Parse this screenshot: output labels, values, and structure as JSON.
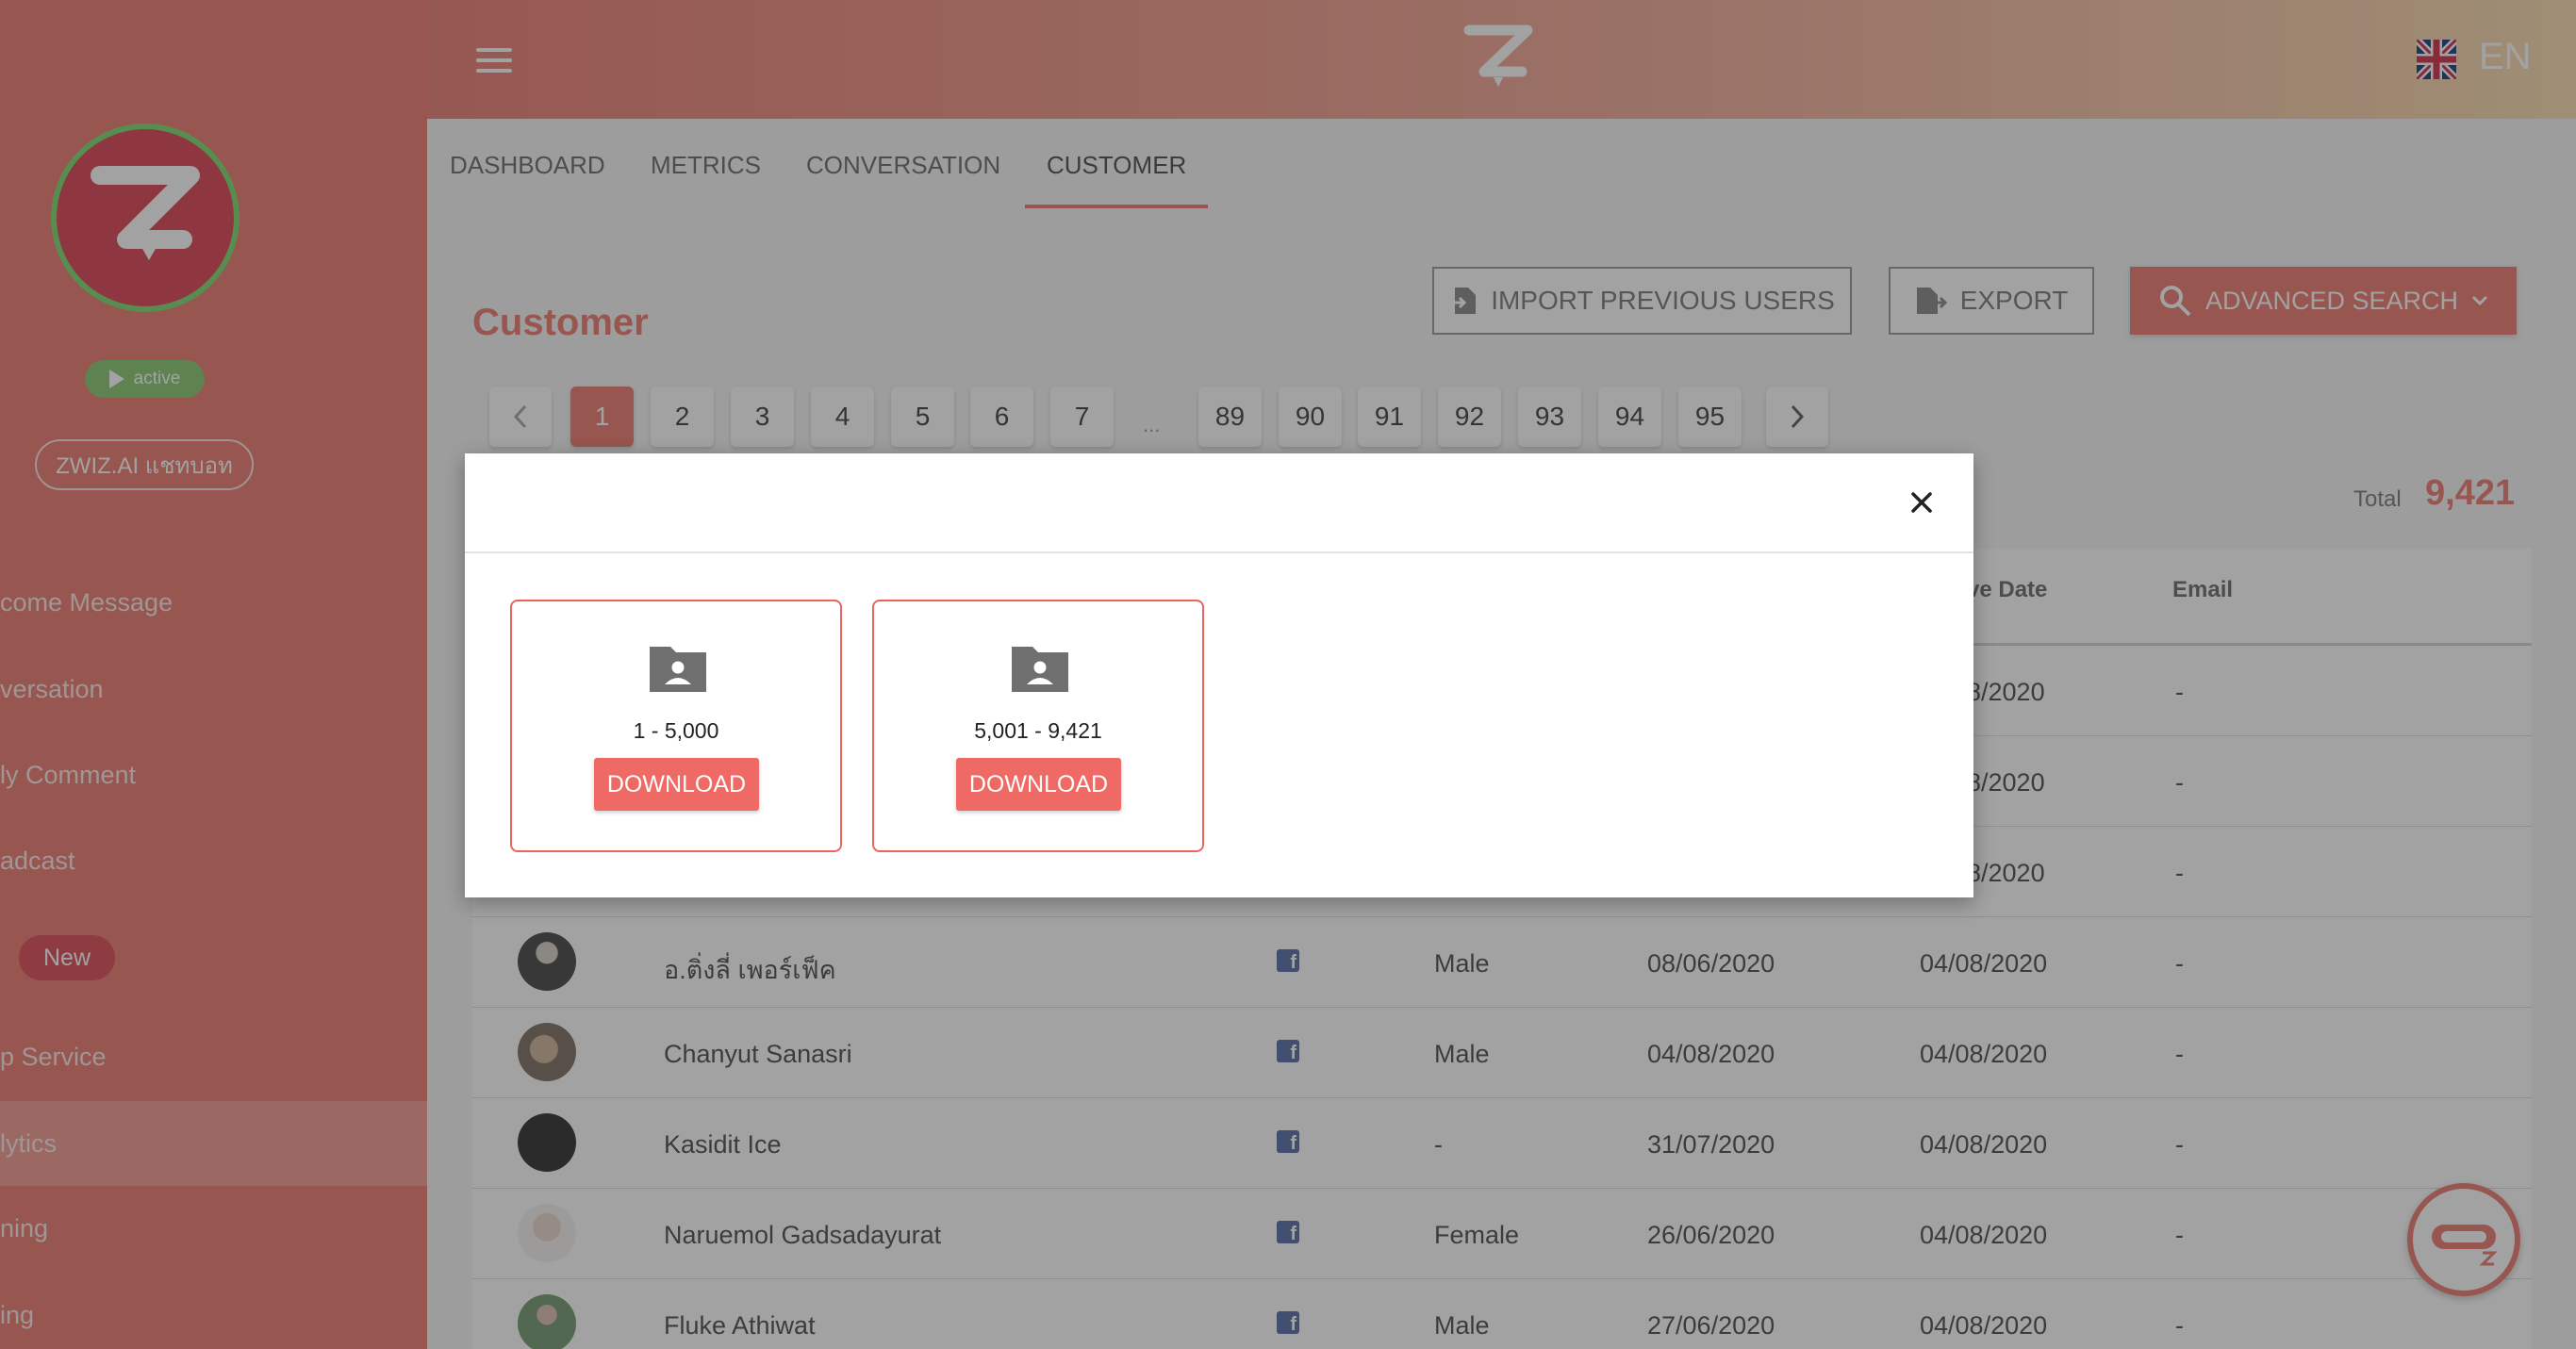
{
  "sidebar": {
    "status": "active",
    "bot_name": "ZWIZ.AI แชทบอท",
    "new_badge": "New",
    "items": [
      {
        "label": "come Message"
      },
      {
        "label": "versation"
      },
      {
        "label": "ly Comment"
      },
      {
        "label": "adcast"
      },
      {
        "label": "p Service"
      },
      {
        "label": "lytics"
      },
      {
        "label": "ning"
      },
      {
        "label": "ing"
      }
    ]
  },
  "header": {
    "language": "EN"
  },
  "tabs": [
    {
      "label": "DASHBOARD"
    },
    {
      "label": "METRICS"
    },
    {
      "label": "CONVERSATION"
    },
    {
      "label": "CUSTOMER"
    }
  ],
  "page": {
    "title": "Customer",
    "import_label": "IMPORT PREVIOUS USERS",
    "export_label": "EXPORT",
    "advanced_search_label": "ADVANCED SEARCH",
    "total_label": "Total",
    "total_value": "9,421"
  },
  "pagination": {
    "pages": [
      "1",
      "2",
      "3",
      "4",
      "5",
      "6",
      "7",
      "89",
      "90",
      "91",
      "92",
      "93",
      "94",
      "95"
    ],
    "current": "1",
    "ellipsis": "..."
  },
  "table": {
    "headers": {
      "active_date": "ve Date",
      "email": "Email"
    },
    "partial_rows": [
      {
        "date2": "8/2020",
        "email": "-"
      },
      {
        "date2": "8/2020",
        "email": "-"
      },
      {
        "date2": "8/2020",
        "email": "-"
      }
    ],
    "rows": [
      {
        "name": "อ.ติ่งลี่ เพอร์เฟ็ค",
        "gender": "Male",
        "date1": "08/06/2020",
        "date2": "04/08/2020",
        "email": "-"
      },
      {
        "name": "Chanyut Sanasri",
        "gender": "Male",
        "date1": "04/08/2020",
        "date2": "04/08/2020",
        "email": "-"
      },
      {
        "name": "Kasidit Ice",
        "gender": "-",
        "date1": "31/07/2020",
        "date2": "04/08/2020",
        "email": "-"
      },
      {
        "name": "Naruemol Gadsadayurat",
        "gender": "Female",
        "date1": "26/06/2020",
        "date2": "04/08/2020",
        "email": "-"
      },
      {
        "name": "Fluke Athiwat",
        "gender": "Male",
        "date1": "27/06/2020",
        "date2": "04/08/2020",
        "email": "-"
      }
    ]
  },
  "modal": {
    "cards": [
      {
        "range": "1 - 5,000",
        "button": "DOWNLOAD"
      },
      {
        "range": "5,001 - 9,421",
        "button": "DOWNLOAD"
      }
    ]
  },
  "colors": {
    "brand": "#e8675a",
    "active_status": "#79c05a",
    "facebook": "#3b5998"
  },
  "icons": [
    "menu-icon",
    "zwiz-logo",
    "uk-flag-icon",
    "import-icon",
    "export-icon",
    "search-icon",
    "chevron-down-icon",
    "chevron-left-icon",
    "chevron-right-icon",
    "facebook-icon",
    "close-icon",
    "folder-user-icon",
    "chatbot-icon"
  ]
}
